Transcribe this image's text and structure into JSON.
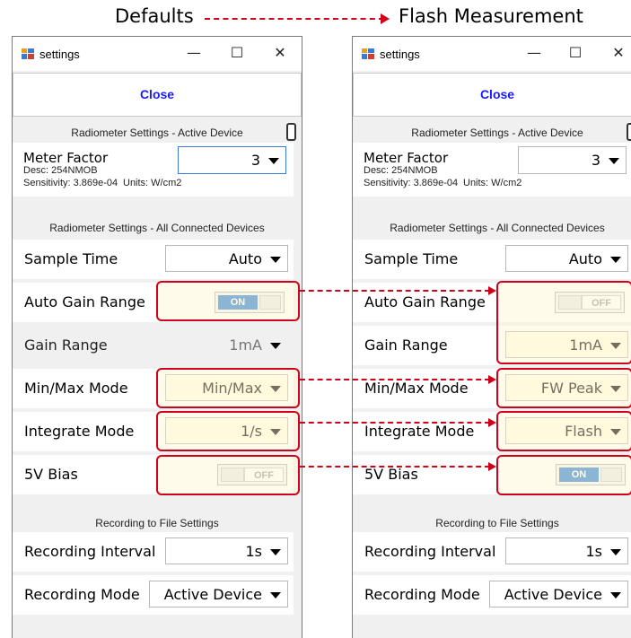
{
  "header": {
    "left_label": "Defaults",
    "right_label": "Flash Measurement"
  },
  "colors": {
    "annotation": "#d0021b",
    "close_text": "#1a1aff",
    "toggle_on": "#2f7fd4"
  },
  "windows": [
    {
      "title": "settings",
      "controls": {
        "minimize": "—",
        "maximize": "☐",
        "close": "✕"
      },
      "close_button": "Close",
      "active_section": "Radiometer Settings - Active Device",
      "meter": {
        "name": "Meter Factor",
        "desc": "Desc: 254NMOB",
        "sensitivity": "Sensitivity: 3.869e-04",
        "units": "Units: W/cm2",
        "value": "3"
      },
      "all_section": "Radiometer Settings - All Connected Devices",
      "rows": {
        "sample_time": {
          "label": "Sample Time",
          "value": "Auto"
        },
        "auto_gain": {
          "label": "Auto Gain Range",
          "state": "ON"
        },
        "gain_range": {
          "label": "Gain Range",
          "value": "1mA"
        },
        "minmax": {
          "label": "Min/Max Mode",
          "value": "Min/Max"
        },
        "integrate": {
          "label": "Integrate Mode",
          "value": "1/s"
        },
        "bias": {
          "label": "5V Bias",
          "state": "OFF"
        }
      },
      "recording_section": "Recording to File Settings",
      "recording": {
        "interval": {
          "label": "Recording Interval",
          "value": "1s"
        },
        "mode": {
          "label": "Recording Mode",
          "value": "Active Device"
        }
      }
    },
    {
      "title": "settings",
      "controls": {
        "minimize": "—",
        "maximize": "☐",
        "close": "✕"
      },
      "close_button": "Close",
      "active_section": "Radiometer Settings - Active Device",
      "meter": {
        "name": "Meter Factor",
        "desc": "Desc: 254NMOB",
        "sensitivity": "Sensitivity: 3.869e-04",
        "units": "Units: W/cm2",
        "value": "3"
      },
      "all_section": "Radiometer Settings - All Connected Devices",
      "rows": {
        "sample_time": {
          "label": "Sample Time",
          "value": "Auto"
        },
        "auto_gain": {
          "label": "Auto Gain Range",
          "state": "OFF"
        },
        "gain_range": {
          "label": "Gain Range",
          "value": "1mA"
        },
        "minmax": {
          "label": "Min/Max Mode",
          "value": "FW Peak"
        },
        "integrate": {
          "label": "Integrate Mode",
          "value": "Flash"
        },
        "bias": {
          "label": "5V Bias",
          "state": "ON"
        }
      },
      "recording_section": "Recording to File Settings",
      "recording": {
        "interval": {
          "label": "Recording Interval",
          "value": "1s"
        },
        "mode": {
          "label": "Recording Mode",
          "value": "Active Device"
        }
      }
    }
  ]
}
